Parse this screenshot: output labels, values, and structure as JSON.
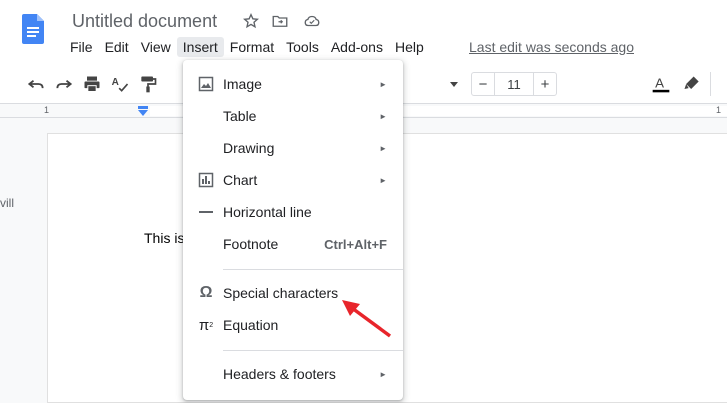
{
  "document": {
    "title": "Untitled document",
    "last_edit": "Last edit was seconds ago",
    "body_text": "This is",
    "side_text": "vill"
  },
  "menubar": {
    "items": [
      "File",
      "Edit",
      "View",
      "Insert",
      "Format",
      "Tools",
      "Add-ons",
      "Help"
    ],
    "active": "Insert"
  },
  "toolbar": {
    "font_size": "11",
    "minus": "−",
    "plus": "+",
    "text_color_letter": "A"
  },
  "ruler": {
    "labels": [
      "1",
      "1"
    ]
  },
  "insert_menu": {
    "items": [
      {
        "label": "Image",
        "icon": "image-icon",
        "submenu": true
      },
      {
        "label": "Table",
        "icon": "",
        "submenu": true
      },
      {
        "label": "Drawing",
        "icon": "",
        "submenu": true
      },
      {
        "label": "Chart",
        "icon": "chart-icon",
        "submenu": true
      },
      {
        "label": "Horizontal line",
        "icon": "horizontal-line-icon",
        "submenu": false
      },
      {
        "label": "Footnote",
        "icon": "",
        "shortcut": "Ctrl+Alt+F"
      },
      {
        "label": "Special characters",
        "icon": "omega-icon",
        "submenu": false
      },
      {
        "label": "Equation",
        "icon": "pi-icon",
        "submenu": false
      },
      {
        "label": "Headers & footers",
        "icon": "",
        "submenu": true
      }
    ],
    "submenu_arrow": "►"
  },
  "colors": {
    "docs_blue": "#4285f4",
    "annotation_red": "#e8252b",
    "active_menu_bg": "#e8eaed"
  }
}
